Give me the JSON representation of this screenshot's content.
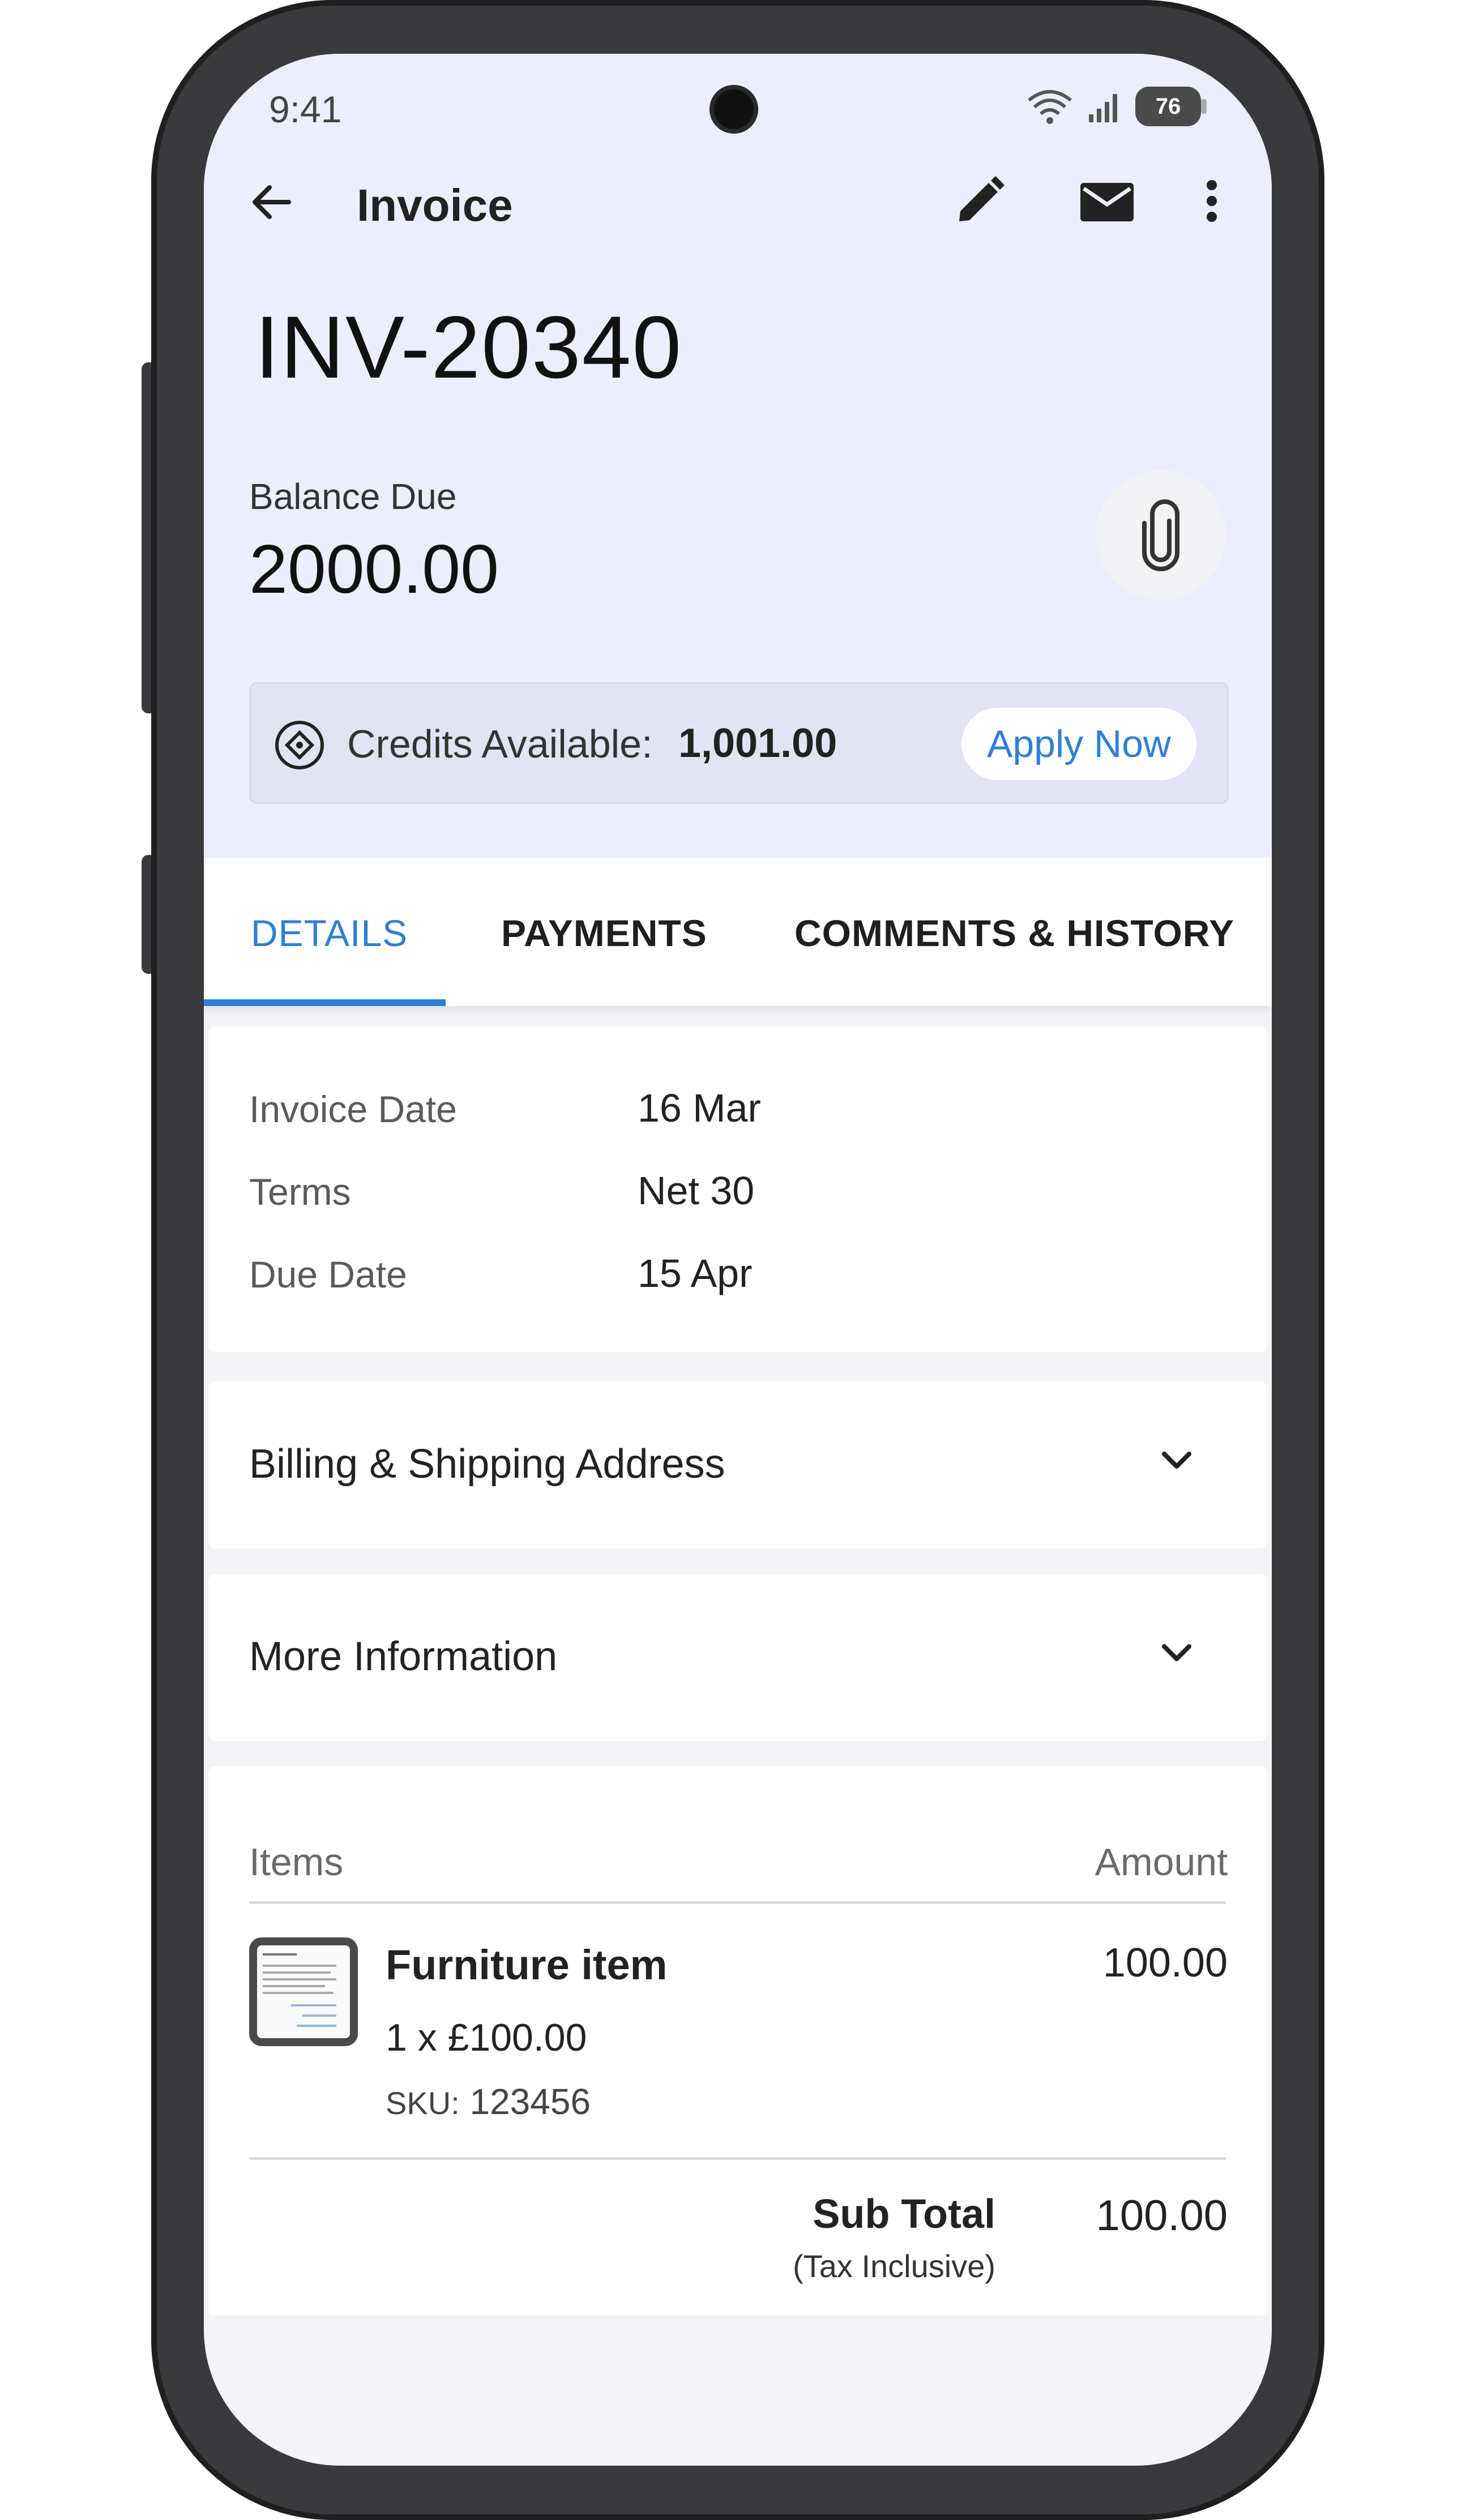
{
  "status_bar": {
    "time": "9:41",
    "battery": "76"
  },
  "appbar": {
    "title": "Invoice"
  },
  "invoice": {
    "number": "INV-20340",
    "balance_label": "Balance Due",
    "balance_value": "2000.00"
  },
  "credits": {
    "label": "Credits Available:",
    "value": "1,001.00",
    "apply_label": "Apply Now"
  },
  "tabs": [
    {
      "label": "DETAILS",
      "active": true
    },
    {
      "label": "PAYMENTS",
      "active": false
    },
    {
      "label": "COMMENTS & HISTORY",
      "active": false
    }
  ],
  "details": {
    "rows": [
      {
        "label": "Invoice Date",
        "value": "16 Mar"
      },
      {
        "label": "Terms",
        "value": "Net 30"
      },
      {
        "label": "Due Date",
        "value": "15 Apr"
      }
    ]
  },
  "sections": {
    "billing": "Billing & Shipping Address",
    "more_info": "More Information"
  },
  "items": {
    "header_items": "Items",
    "header_amount": "Amount",
    "list": [
      {
        "name": "Furniture item",
        "qty": "1 x £100.00",
        "sku_label": "SKU:",
        "sku": " 123456",
        "amount": "100.00"
      }
    ],
    "subtotal_label": "Sub Total",
    "subtotal_note": "(Tax Inclusive)",
    "subtotal_value": "100.00"
  },
  "colors": {
    "accent": "#2d7fd8",
    "header_bg": "#eceefe"
  }
}
